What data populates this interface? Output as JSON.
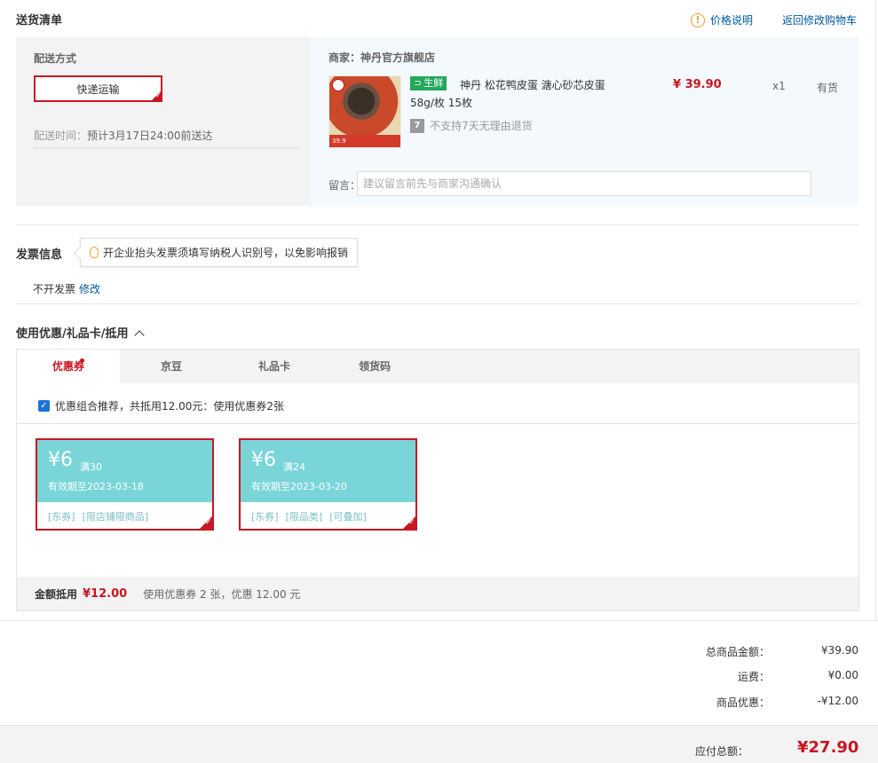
{
  "delivery": {
    "title": "送货清单",
    "price_note": "价格说明",
    "back_cart": "返回修改购物车",
    "method_label": "配送方式",
    "method_value": "快递运输",
    "time_label": "配送时间：",
    "time_value": "预计3月17日24:00前送达"
  },
  "merchant": {
    "label": "商家：",
    "name": "神丹官方旗舰店"
  },
  "product": {
    "fresh_tag": "生鲜",
    "name": "神丹 松花鸭皮蛋 溏心砂芯皮蛋",
    "spec": "58g/枚 15枚",
    "no_return": "不支持7天无理由退货",
    "price": "¥ 39.90",
    "qty": "x1",
    "stock": "有货",
    "image_price_tag": "39.9"
  },
  "message": {
    "label": "留言：",
    "placeholder": "建议留言前先与商家沟通确认"
  },
  "invoice": {
    "title": "发票信息",
    "tip": "开企业抬头发票须填写纳税人识别号，以免影响报销",
    "status": "不开发票",
    "edit": "修改"
  },
  "discount": {
    "title": "使用优惠/礼品卡/抵用",
    "tabs": [
      "优惠券",
      "京豆",
      "礼品卡",
      "领货码"
    ],
    "combo_text": "优惠组合推荐，共抵用12.00元：使用优惠券2张",
    "coupons": [
      {
        "amount": "¥6",
        "condition": "满30",
        "valid": "有效期至2023-03-18",
        "tags": [
          "[东券]",
          "[限店铺限商品]"
        ]
      },
      {
        "amount": "¥6",
        "condition": "满24",
        "valid": "有效期至2023-03-20",
        "tags": [
          "[东券]",
          "[限品类]",
          "[可叠加]"
        ]
      }
    ],
    "deduct_label": "金额抵用",
    "deduct_amount": "¥12.00",
    "deduct_note": "使用优惠券 2 张，优惠 12.00 元"
  },
  "summary": {
    "total_label": "总商品金额：",
    "total_value": "¥39.90",
    "freight_label": "运费：",
    "freight_value": "¥0.00",
    "discount_label": "商品优惠：",
    "discount_value": "-¥12.00",
    "payable_label": "应付总额：",
    "payable_value": "¥27.90"
  },
  "colors": {
    "accent_red": "#c81623",
    "link_blue": "#005aa0",
    "coupon_teal": "#79d5d8",
    "fresh_green": "#23a85a"
  }
}
